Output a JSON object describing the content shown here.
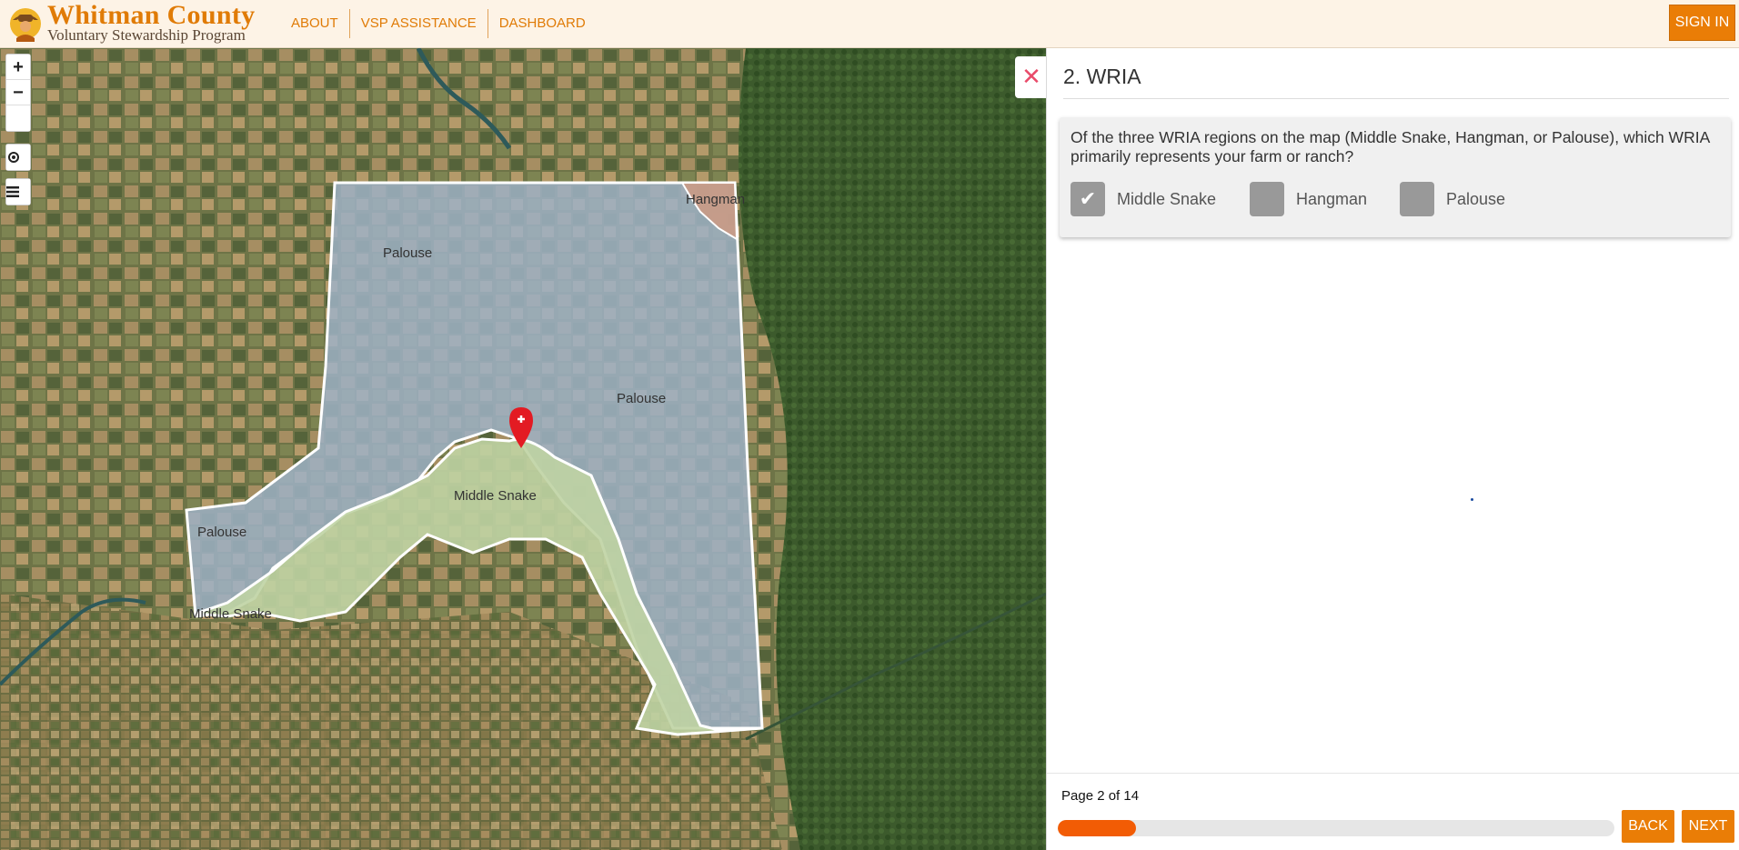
{
  "header": {
    "logo_title": "Whitman County",
    "logo_subtitle": "Voluntary Stewardship Program",
    "nav": [
      "ABOUT",
      "VSP ASSISTANCE",
      "DASHBOARD"
    ],
    "signin_label": "SIGN IN"
  },
  "map": {
    "controls": {
      "zoom_in": "+",
      "zoom_out": "−",
      "locate_icon": "crosshair-icon",
      "layers_icon": "menu-icon"
    },
    "region_labels": [
      "Hangman",
      "Palouse",
      "Palouse",
      "Middle Snake",
      "Palouse",
      "Middle Snake"
    ],
    "colors": {
      "palouse": "#9fb2c6",
      "middle_snake": "#bfd3a3",
      "hangman": "#c99a85",
      "marker": "#e31b23"
    }
  },
  "panel": {
    "close_icon": "close-icon",
    "title": "2. WRIA",
    "question": "Of the three WRIA regions on the map (Middle Snake, Hangman, or Palouse), which WRIA primarily represents your farm or ranch?",
    "options": [
      {
        "label": "Middle Snake",
        "checked": true
      },
      {
        "label": "Hangman",
        "checked": false
      },
      {
        "label": "Palouse",
        "checked": false
      }
    ],
    "page_label": "Page 2 of 14",
    "progress": 0.14,
    "back_label": "BACK",
    "next_label": "NEXT",
    "accent": "#ea7d06"
  }
}
